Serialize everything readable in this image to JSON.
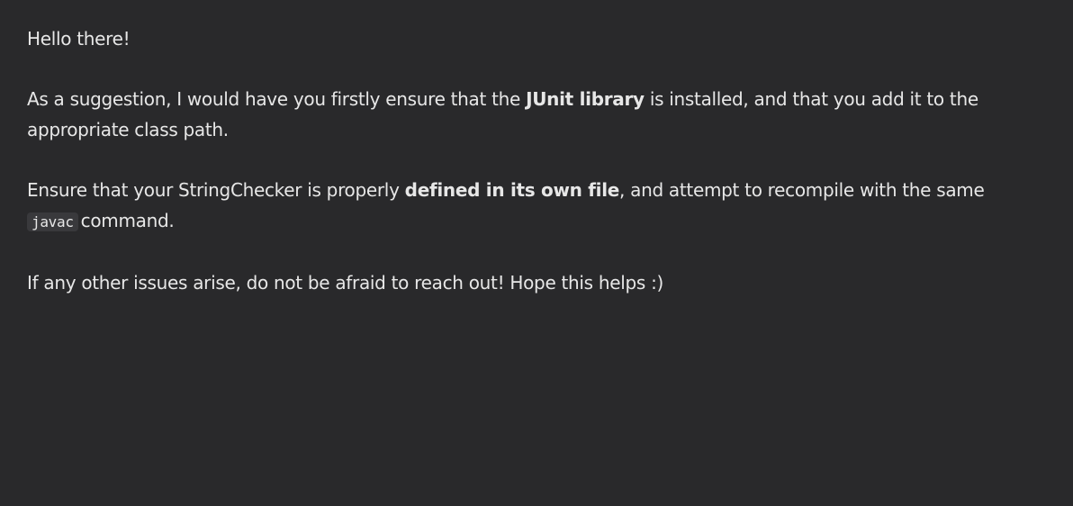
{
  "message": {
    "greeting": "Hello there!",
    "para2": {
      "before": "As a suggestion, I would have you firstly ensure that the ",
      "strong": "JUnit library",
      "after": " is installed, and that you add it to the appropriate class path."
    },
    "para3": {
      "before": "Ensure that your StringChecker is properly ",
      "strong": "defined in its own file",
      "middle": ", and attempt to recompile with the same ",
      "code": "javac",
      "after": "command."
    },
    "closing": "If any other issues arise, do not be afraid to reach out! Hope this helps :)"
  }
}
